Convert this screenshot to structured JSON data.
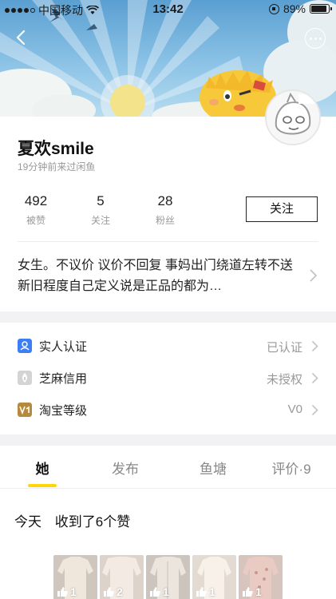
{
  "status_bar": {
    "carrier": "中国移动",
    "time": "13:42",
    "battery": "89%",
    "battery_level": 0.89
  },
  "profile": {
    "nickname": "夏欢smile",
    "last_seen": "19分钟前来过闲鱼",
    "stats": [
      {
        "value": "492",
        "label": "被赞"
      },
      {
        "value": "5",
        "label": "关注"
      },
      {
        "value": "28",
        "label": "粉丝"
      }
    ],
    "follow_label": "关注",
    "bio": "女生。不议价 议价不回复 事妈出门绕道左转不送 新旧程度自己定义说是正品的都为…"
  },
  "verification": [
    {
      "label": "实人认证",
      "value": "已认证",
      "icon": "person-id-icon",
      "color": "#3d7df5"
    },
    {
      "label": "芝麻信用",
      "value": "未授权",
      "icon": "sesame-credit-icon",
      "color": "#bdbdbd"
    },
    {
      "label": "淘宝等级",
      "value": "V0",
      "icon": "taobao-level-icon",
      "color": "#b58a3c"
    }
  ],
  "tabs": [
    {
      "label": "她",
      "active": true
    },
    {
      "label": "发布",
      "active": false
    },
    {
      "label": "鱼塘",
      "active": false
    },
    {
      "label": "评价·9",
      "active": false
    }
  ],
  "activity": {
    "day": "今天",
    "summary": "收到了6个赞",
    "items": [
      {
        "likes": "1",
        "color": "#d9cfc6"
      },
      {
        "likes": "2",
        "color": "#e3d8cf"
      },
      {
        "likes": "1",
        "color": "#d6d0c8"
      },
      {
        "likes": "1",
        "color": "#ece4da"
      },
      {
        "likes": "1",
        "color": "#d8b8b0"
      }
    ]
  },
  "colors": {
    "accent": "#ffd60a",
    "sky": "#6aaedb"
  }
}
